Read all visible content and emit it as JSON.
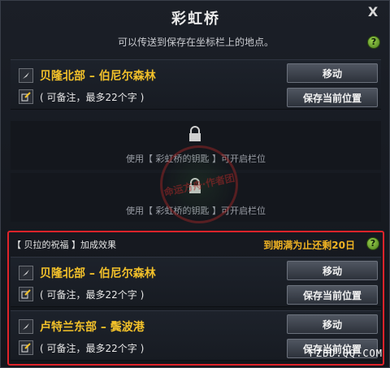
{
  "window": {
    "title": "彩虹桥",
    "close_glyph": "X",
    "subtitle": "可以传送到保存在坐标栏上的地点。",
    "help_glyph": "?"
  },
  "slots": [
    {
      "location": "贝隆北部 – 伯尼尔森林",
      "memo": "( 可备注，最多22个字 )",
      "move_label": "移动",
      "save_label": "保存当前位置"
    }
  ],
  "locked_slots": [
    {
      "text": "使用【 彩虹桥的钥匙 】可开启栏位"
    },
    {
      "text": "使用【 彩虹桥的钥匙 】可开启栏位"
    }
  ],
  "bonus": {
    "header": "【 贝拉的祝福 】加成效果",
    "remaining": "到期满为止还剩20日",
    "help_glyph": "?",
    "slots": [
      {
        "location": "贝隆北部 – 伯尼尔森林",
        "memo": "( 可备注，最多22个字 )",
        "move_label": "移动",
        "save_label": "保存当前位置"
      },
      {
        "location": "卢特兰东部 – 鬓波港",
        "memo": "( 可备注，最多22个字 )",
        "move_label": "移动",
        "save_label": "保存当前位置"
      }
    ]
  },
  "watermark": "命运方舟·作者团",
  "site_mark": "FZBD.QQ.COM",
  "colors": {
    "accent": "#f3c12a",
    "highlight_border": "#e0232a",
    "help_green": "#7bb53a"
  }
}
